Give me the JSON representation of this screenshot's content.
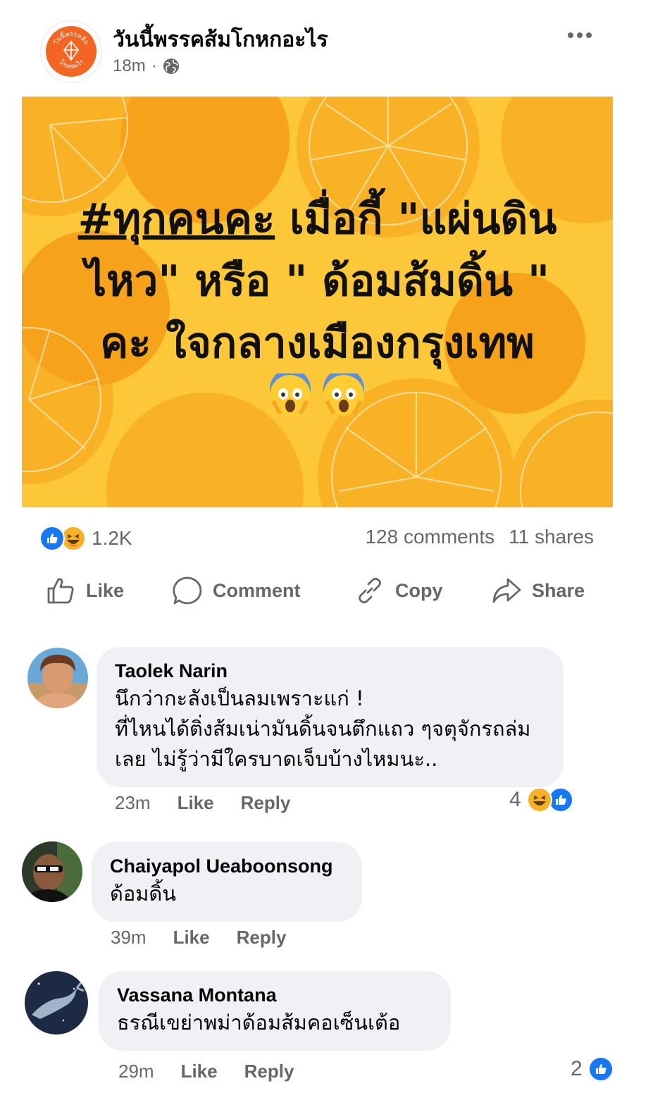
{
  "post": {
    "page_name": "วันนี้พรรคส้มโกหกอะไร",
    "time": "18m",
    "separator": "·",
    "image": {
      "hashtag": "#ทุกคนคะ",
      "text_rest": " เมื่อกี้ \"แผ่นดินไหว\" หรือ \" ด้อมส้มดิ้น \" คะ ใจกลางเมืองกรุงเทพ",
      "emoji": "scream-emoji",
      "colors": {
        "background": "#fdc73a",
        "orange": "#f7a21b",
        "deep_orange": "#f59a12"
      }
    },
    "avatar_text": {
      "top": "วันนี้พรรคส้ม",
      "bottom": "โกหกอะไร"
    }
  },
  "stats": {
    "reaction_count": "1.2K",
    "comments": "128 comments",
    "shares": "11 shares"
  },
  "actions": {
    "like": "Like",
    "comment": "Comment",
    "copy": "Copy",
    "share": "Share"
  },
  "comments": [
    {
      "name": "Taolek Narin",
      "lines": [
        "นึกว่ากะลังเป็นลมเพราะแก่ !",
        "ที่ไหนได้ติ่งส้มเน่ามันดิ้นจนตึกแถว ๆจตุจักรถล่ม",
        "เลย ไม่รู้ว่ามีใครบาดเจ็บบ้างไหมนะ.."
      ],
      "time": "23m",
      "like": "Like",
      "reply": "Reply",
      "reaction_count": "4"
    },
    {
      "name": "Chaiyapol Ueaboonsong",
      "lines": [
        "ด้อมดิ้น"
      ],
      "time": "39m",
      "like": "Like",
      "reply": "Reply"
    },
    {
      "name": "Vassana Montana",
      "lines": [
        "ธรณีเขย่าพม่าด้อมส้มคอเซ็นเต้อ"
      ],
      "time": "29m",
      "like": "Like",
      "reply": "Reply",
      "reaction_count": "2"
    }
  ],
  "colors": {
    "facebook_blue": "#1877f2",
    "secondary_text": "#65676b",
    "bubble": "#eff1f4",
    "haha_yellow": "#f7b125"
  }
}
